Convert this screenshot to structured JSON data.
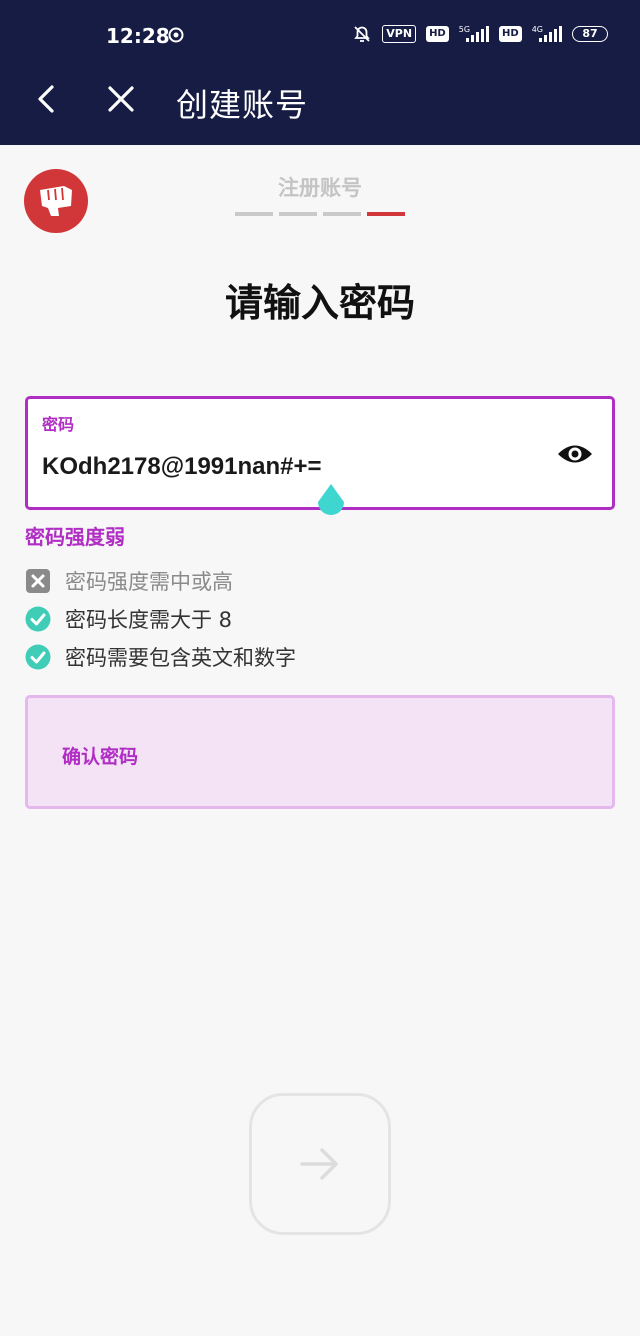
{
  "status_bar": {
    "time": "12:28",
    "vpn": "VPN",
    "hd1": "HD",
    "net1": "5G",
    "hd2": "HD",
    "net2": "4G",
    "battery": "87"
  },
  "header": {
    "title": "创建账号",
    "back_icon": "chevron-left-icon",
    "close_icon": "close-icon"
  },
  "progress": {
    "step_label": "注册账号",
    "total_steps": 4,
    "current_step": 4
  },
  "heading": "请输入密码",
  "password_field": {
    "label": "密码",
    "value": "KOdh2178@1991nan#+=",
    "toggle_icon": "eye-icon"
  },
  "strength_text": "密码强度弱",
  "rules": [
    {
      "text": "密码强度需中或高",
      "status": "fail"
    },
    {
      "text": "密码长度需大于 8",
      "status": "pass"
    },
    {
      "text": "密码需要包含英文和数字",
      "status": "pass"
    }
  ],
  "confirm_field": {
    "label": "确认密码"
  },
  "colors": {
    "header_bg": "#161c44",
    "accent": "#b02ec4",
    "brand_red": "#d13639",
    "check_teal": "#3fcdb8"
  }
}
